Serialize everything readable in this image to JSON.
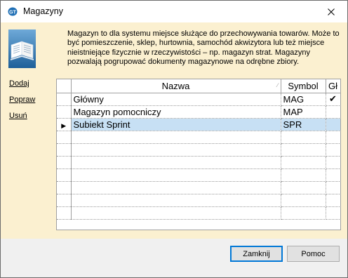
{
  "window": {
    "title": "Magazyny",
    "icon": "gt-app-icon"
  },
  "description": "Magazyn to dla systemu miejsce służące do przechowywania towarów. Może to być pomieszczenie, sklep, hurtownia, samochód akwizytora lub też miejsce nieistniejące fizycznie w rzeczywistości – np. magazyn strat. Magazyny pozwalają pogrupować dokumenty magazynowe na odrębne zbiory.",
  "actions": {
    "add": "Dodaj",
    "edit": "Popraw",
    "delete": "Usuń"
  },
  "grid": {
    "columns": {
      "name": "Nazwa",
      "symbol": "Symbol",
      "main": "Gł"
    },
    "rows": [
      {
        "name": "Główny",
        "symbol": "MAG",
        "main": true,
        "selected": false
      },
      {
        "name": "Magazyn pomocniczy",
        "symbol": "MAP",
        "main": false,
        "selected": false
      },
      {
        "name": "Subiekt Sprint",
        "symbol": "SPR",
        "main": false,
        "selected": true
      }
    ]
  },
  "buttons": {
    "close": "Zamknij",
    "help": "Pomoc"
  },
  "colors": {
    "content_bg": "#fbf0d0",
    "selection": "#c7e0f4",
    "default_button_border": "#0078d7"
  }
}
